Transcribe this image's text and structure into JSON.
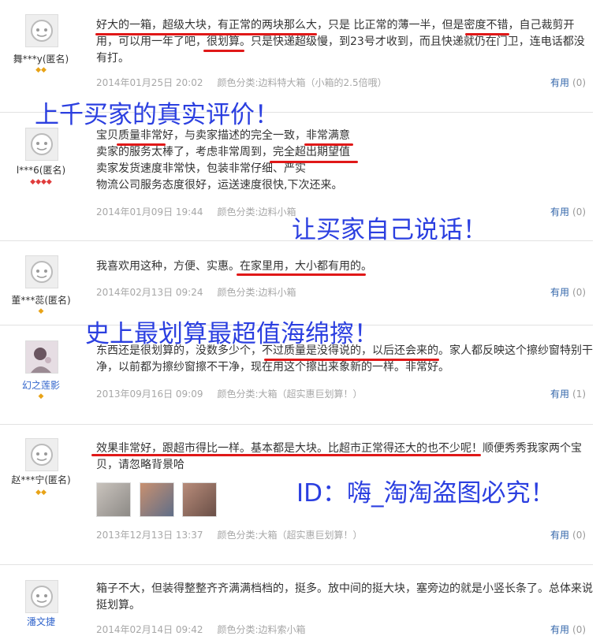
{
  "reviews": [
    {
      "user": "舞***y(匿名)",
      "text": "好大的一箱，超级大块，有正常的两块那么大，只是 比正常的薄一半，但是密度不错，自己裁剪开用，可以用一年了吧，很划算。只是快递超级慢，到23号才收到，而且快递就仍在门卫，连电话都没有打。",
      "date": "2014年01月25日 20:02",
      "category": "颜色分类:边料特大箱（小箱的2.5倍哦）",
      "useful_label": "有用",
      "useful_count": "(0)"
    },
    {
      "user": "l***6(匿名)",
      "lines": [
        "宝贝质量非常好，与卖家描述的完全一致，非常满意",
        "卖家的服务太棒了，考虑非常周到，完全超出期望值",
        "卖家发货速度非常快，包装非常仔细、严实",
        "物流公司服务态度很好，运送速度很快,下次还来。"
      ],
      "date": "2014年01月09日 19:44",
      "category": "颜色分类:边料小箱",
      "useful_label": "有用",
      "useful_count": "(0)"
    },
    {
      "user": "董***蕊(匿名)",
      "text": "我喜欢用这种，方便、实惠。在家里用，大小都有用的。",
      "date": "2014年02月13日 09:24",
      "category": "颜色分类:边料小箱",
      "useful_label": "有用",
      "useful_count": "(0)"
    },
    {
      "user": "幻之莲影",
      "text": "东西还是很划算的，没数多少个，不过质量是没得说的，以后还会来的。家人都反映这个擦纱窗特别干净，以前都为擦纱窗擦不干净，现在用这个擦出来象新的一样。非常好。",
      "date": "2013年09月16日 09:09",
      "category": "颜色分类:大箱（超实惠巨划算！）",
      "useful_label": "有用",
      "useful_count": "(1)"
    },
    {
      "user": "赵***宁(匿名)",
      "text": "效果非常好，跟超市得比一样。基本都是大块。比超市正常得还大的也不少呢！顺便秀秀我家两个宝贝，请忽略背景哈",
      "date": "2013年12月13日 13:37",
      "category": "颜色分类:大箱（超实惠巨划算！）",
      "useful_label": "有用",
      "useful_count": "(0)"
    },
    {
      "user": "潘文捷",
      "text": "箱子不大，但装得整整齐齐满满档档的，挺多。放中间的挺大块，塞旁边的就是小竖长条了。总体来说挺划算。",
      "date": "2014年02月14日 09:42",
      "category": "颜色分类:边料索小箱",
      "useful_label": "有用",
      "useful_count": "(0)"
    }
  ],
  "overlays": {
    "o1": "上千买家的真实评价！",
    "o2": "让买家自己说话！",
    "o3": "史上最划算最超值海绵擦！",
    "o4": "ID：嗨_淘淘盗图必究！"
  },
  "colors": {
    "overlay": "#2b3fe0",
    "underline": "#e01818",
    "link": "#3366aa"
  }
}
